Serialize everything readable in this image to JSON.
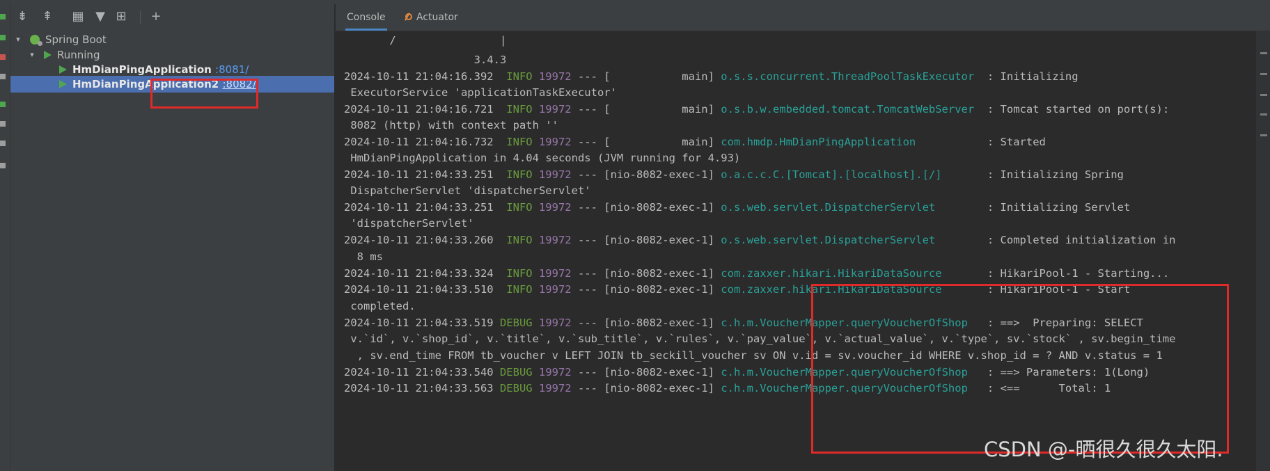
{
  "tree": {
    "toolbar_icons": [
      "expand-all-icon",
      "collapse-all-icon",
      "group-icon",
      "filter-icon",
      "new-group-icon",
      "add-icon"
    ],
    "root_label": "Spring Boot",
    "running_label": "Running",
    "apps": [
      {
        "name": "HmDianPingApplication",
        "port": ":8081/"
      },
      {
        "name": "HmDianPingApplication2",
        "port": ":8082/"
      }
    ]
  },
  "tabs": [
    {
      "label": "Console"
    },
    {
      "label": "Actuator"
    }
  ],
  "console": {
    "lines": [
      {
        "segments": [
          {
            "t": "       /                |",
            "c": ""
          }
        ]
      },
      {
        "segments": [
          {
            "t": "                    3.4.3",
            "c": ""
          }
        ]
      },
      {
        "segments": [
          {
            "t": "2024-10-11 21:04:16.392  ",
            "c": ""
          },
          {
            "t": "INFO",
            "c": "lvl-info"
          },
          {
            "t": " ",
            "c": ""
          },
          {
            "t": "19972",
            "c": "pid"
          },
          {
            "t": " --- [           main] ",
            "c": ""
          },
          {
            "t": "o.s.s.concurrent.ThreadPoolTaskExecutor",
            "c": "logger"
          },
          {
            "t": "  : Initializing",
            "c": ""
          }
        ]
      },
      {
        "segments": [
          {
            "t": " ExecutorService 'applicationTaskExecutor'",
            "c": ""
          }
        ]
      },
      {
        "segments": [
          {
            "t": "2024-10-11 21:04:16.721  ",
            "c": ""
          },
          {
            "t": "INFO",
            "c": "lvl-info"
          },
          {
            "t": " ",
            "c": ""
          },
          {
            "t": "19972",
            "c": "pid"
          },
          {
            "t": " --- [           main] ",
            "c": ""
          },
          {
            "t": "o.s.b.w.embedded.tomcat.TomcatWebServer",
            "c": "logger"
          },
          {
            "t": "  : Tomcat started on port(s):",
            "c": ""
          }
        ]
      },
      {
        "segments": [
          {
            "t": " 8082 (http) with context path ''",
            "c": ""
          }
        ]
      },
      {
        "segments": [
          {
            "t": "2024-10-11 21:04:16.732  ",
            "c": ""
          },
          {
            "t": "INFO",
            "c": "lvl-info"
          },
          {
            "t": " ",
            "c": ""
          },
          {
            "t": "19972",
            "c": "pid"
          },
          {
            "t": " --- [           main] ",
            "c": ""
          },
          {
            "t": "com.hmdp.HmDianPingApplication",
            "c": "logger"
          },
          {
            "t": "           : Started",
            "c": ""
          }
        ]
      },
      {
        "segments": [
          {
            "t": " HmDianPingApplication in 4.04 seconds (JVM running for 4.93)",
            "c": ""
          }
        ]
      },
      {
        "segments": [
          {
            "t": "2024-10-11 21:04:33.251  ",
            "c": ""
          },
          {
            "t": "INFO",
            "c": "lvl-info"
          },
          {
            "t": " ",
            "c": ""
          },
          {
            "t": "19972",
            "c": "pid"
          },
          {
            "t": " --- [nio-8082-exec-1] ",
            "c": ""
          },
          {
            "t": "o.a.c.c.C.[Tomcat].[localhost].[/]",
            "c": "logger"
          },
          {
            "t": "       : Initializing Spring",
            "c": ""
          }
        ]
      },
      {
        "segments": [
          {
            "t": " DispatcherServlet 'dispatcherServlet'",
            "c": ""
          }
        ]
      },
      {
        "segments": [
          {
            "t": "2024-10-11 21:04:33.251  ",
            "c": ""
          },
          {
            "t": "INFO",
            "c": "lvl-info"
          },
          {
            "t": " ",
            "c": ""
          },
          {
            "t": "19972",
            "c": "pid"
          },
          {
            "t": " --- [nio-8082-exec-1] ",
            "c": ""
          },
          {
            "t": "o.s.web.servlet.DispatcherServlet",
            "c": "logger"
          },
          {
            "t": "        : Initializing Servlet",
            "c": ""
          }
        ]
      },
      {
        "segments": [
          {
            "t": " 'dispatcherServlet'",
            "c": ""
          }
        ]
      },
      {
        "segments": [
          {
            "t": "2024-10-11 21:04:33.260  ",
            "c": ""
          },
          {
            "t": "INFO",
            "c": "lvl-info"
          },
          {
            "t": " ",
            "c": ""
          },
          {
            "t": "19972",
            "c": "pid"
          },
          {
            "t": " --- [nio-8082-exec-1] ",
            "c": ""
          },
          {
            "t": "o.s.web.servlet.DispatcherServlet",
            "c": "logger"
          },
          {
            "t": "        : Completed initialization in",
            "c": ""
          }
        ]
      },
      {
        "segments": [
          {
            "t": "  8 ms",
            "c": ""
          }
        ]
      },
      {
        "segments": [
          {
            "t": "2024-10-11 21:04:33.324  ",
            "c": ""
          },
          {
            "t": "INFO",
            "c": "lvl-info"
          },
          {
            "t": " ",
            "c": ""
          },
          {
            "t": "19972",
            "c": "pid"
          },
          {
            "t": " --- [nio-8082-exec-1] ",
            "c": ""
          },
          {
            "t": "com.zaxxer.hikari.HikariDataSource",
            "c": "logger"
          },
          {
            "t": "       : HikariPool-1 - Starting...",
            "c": ""
          }
        ]
      },
      {
        "segments": [
          {
            "t": "2024-10-11 21:04:33.510  ",
            "c": ""
          },
          {
            "t": "INFO",
            "c": "lvl-info"
          },
          {
            "t": " ",
            "c": ""
          },
          {
            "t": "19972",
            "c": "pid"
          },
          {
            "t": " --- [nio-8082-exec-1] ",
            "c": ""
          },
          {
            "t": "com.zaxxer.hikari.HikariDataSource",
            "c": "logger"
          },
          {
            "t": "       : HikariPool-1 - Start",
            "c": ""
          }
        ]
      },
      {
        "segments": [
          {
            "t": " completed.",
            "c": ""
          }
        ]
      },
      {
        "segments": [
          {
            "t": "2024-10-11 21:04:33.519 ",
            "c": ""
          },
          {
            "t": "DEBUG",
            "c": "lvl-debug"
          },
          {
            "t": " ",
            "c": ""
          },
          {
            "t": "19972",
            "c": "pid"
          },
          {
            "t": " --- [nio-8082-exec-1] ",
            "c": ""
          },
          {
            "t": "c.h.m.VoucherMapper.queryVoucherOfShop",
            "c": "logger"
          },
          {
            "t": "   : ==>  Preparing: SELECT",
            "c": ""
          }
        ]
      },
      {
        "segments": [
          {
            "t": " v.`id`, v.`shop_id`, v.`title`, v.`sub_title`, v.`rules`, v.`pay_value`, v.`actual_value`, v.`type`, sv.`stock` , sv.begin_time",
            "c": ""
          }
        ]
      },
      {
        "segments": [
          {
            "t": "  , sv.end_time FROM tb_voucher v LEFT JOIN tb_seckill_voucher sv ON v.id = sv.voucher_id WHERE v.shop_id = ? AND v.status = 1",
            "c": ""
          }
        ]
      },
      {
        "segments": [
          {
            "t": "2024-10-11 21:04:33.540 ",
            "c": ""
          },
          {
            "t": "DEBUG",
            "c": "lvl-debug"
          },
          {
            "t": " ",
            "c": ""
          },
          {
            "t": "19972",
            "c": "pid"
          },
          {
            "t": " --- [nio-8082-exec-1] ",
            "c": ""
          },
          {
            "t": "c.h.m.VoucherMapper.queryVoucherOfShop",
            "c": "logger"
          },
          {
            "t": "   : ==> Parameters: 1(Long)",
            "c": ""
          }
        ]
      },
      {
        "segments": [
          {
            "t": "2024-10-11 21:04:33.563 ",
            "c": ""
          },
          {
            "t": "DEBUG",
            "c": "lvl-debug"
          },
          {
            "t": " ",
            "c": ""
          },
          {
            "t": "19972",
            "c": "pid"
          },
          {
            "t": " --- [nio-8082-exec-1] ",
            "c": ""
          },
          {
            "t": "c.h.m.VoucherMapper.queryVoucherOfShop",
            "c": "logger"
          },
          {
            "t": "   : <==      Total: 1",
            "c": ""
          }
        ]
      }
    ]
  },
  "watermark": "CSDN @-晒很久很久太阳.",
  "colors": {
    "highlight_box": "#e02a2a",
    "selection": "#4b6eaf",
    "logger": "#2aa198",
    "pid": "#9876aa",
    "level": "#6a9c3e"
  }
}
